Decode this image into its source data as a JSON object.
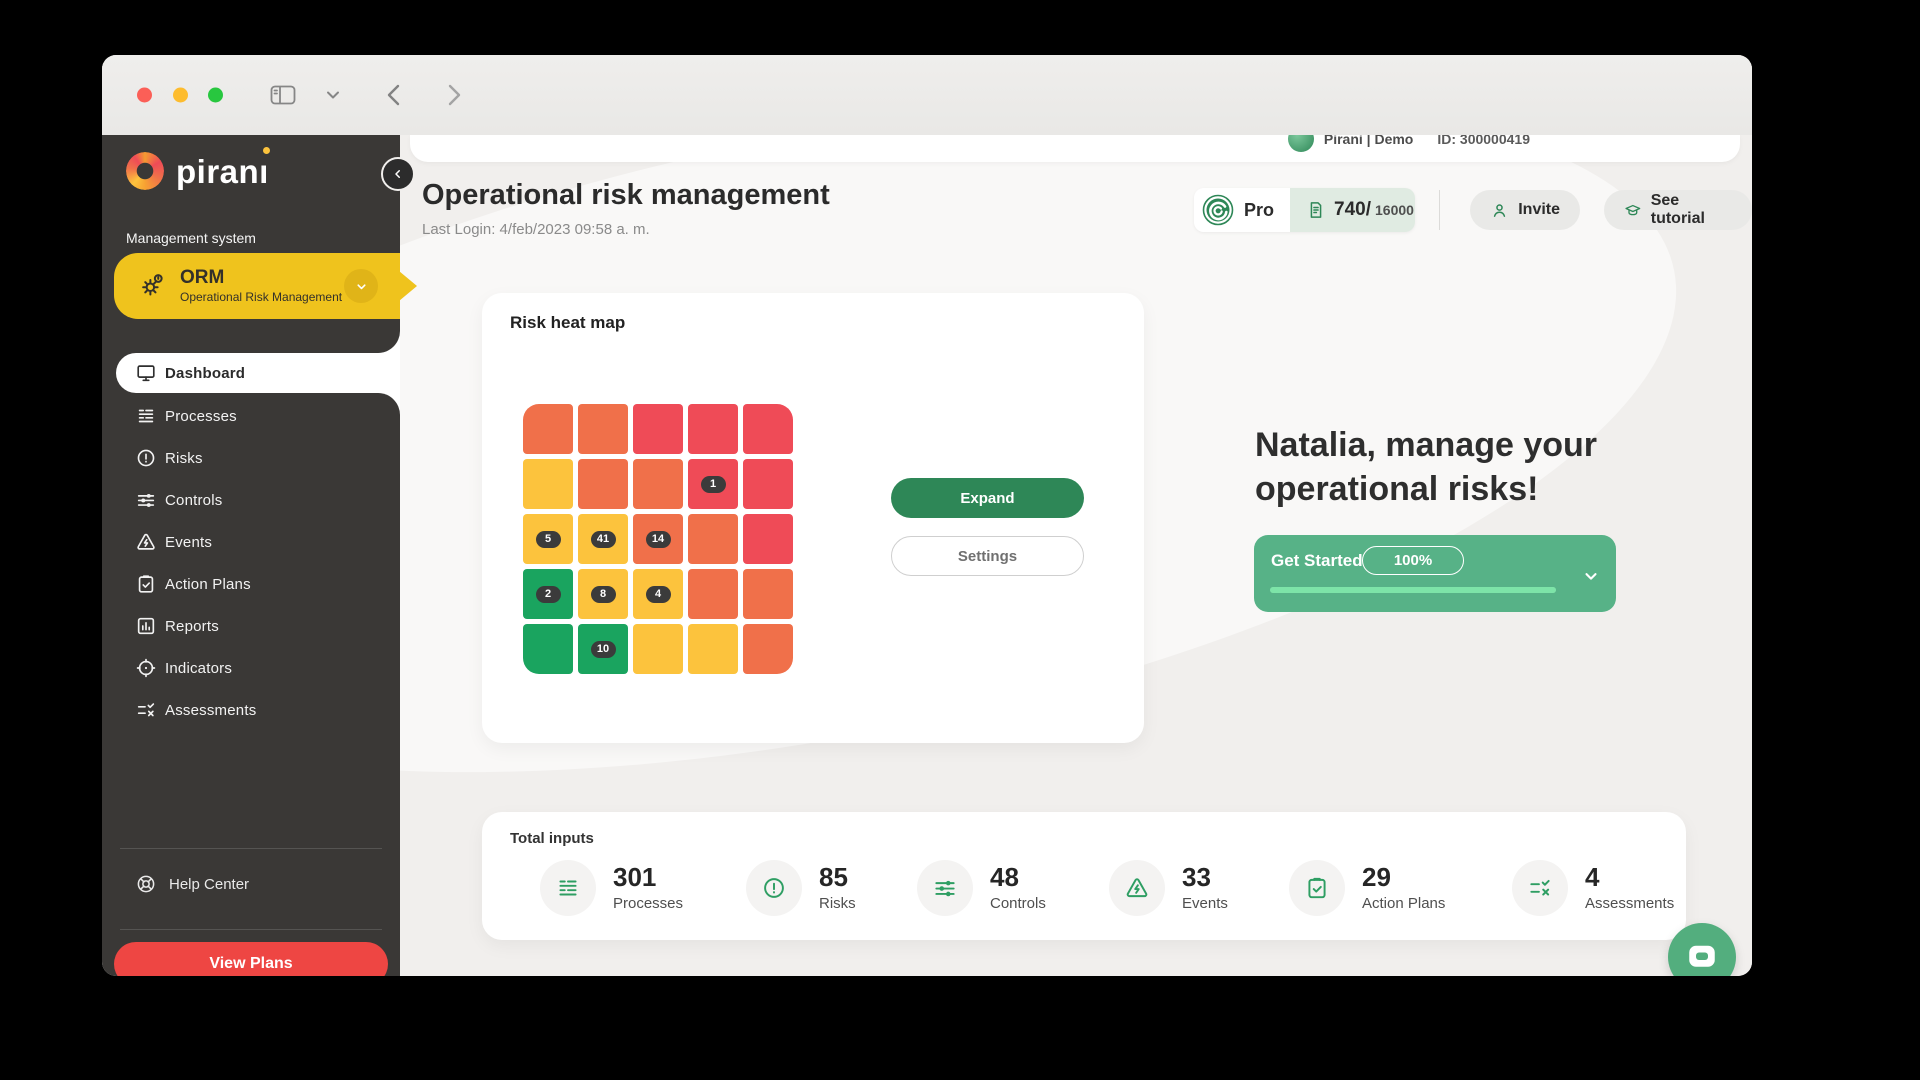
{
  "chrome": {
    "traffic_lights": [
      "close",
      "minimize",
      "zoom"
    ],
    "toolbar_icons": [
      "sidebar-toggle",
      "chevron-down",
      "back-arrow",
      "forward-arrow"
    ]
  },
  "sidebar": {
    "logo_text": "pirani",
    "section_label": "Management system",
    "orm": {
      "title": "ORM",
      "subtitle": "Operational Risk Management"
    },
    "items": [
      {
        "icon": "dashboard",
        "label": "Dashboard",
        "active": true
      },
      {
        "icon": "processes",
        "label": "Processes",
        "active": false
      },
      {
        "icon": "risks",
        "label": "Risks",
        "active": false
      },
      {
        "icon": "controls",
        "label": "Controls",
        "active": false
      },
      {
        "icon": "events",
        "label": "Events",
        "active": false
      },
      {
        "icon": "action-plans",
        "label": "Action Plans",
        "active": false
      },
      {
        "icon": "reports",
        "label": "Reports",
        "active": false
      },
      {
        "icon": "indicators",
        "label": "Indicators",
        "active": false
      },
      {
        "icon": "assessments",
        "label": "Assessments",
        "active": false
      }
    ],
    "help_center_label": "Help Center",
    "view_plans_label": "View Plans"
  },
  "topbar": {
    "account_name": "Pirani | Demo",
    "account_id": "ID: 300000419"
  },
  "header": {
    "title": "Operational risk management",
    "last_login": "Last Login: 4/feb/2023 09:58 a. m.",
    "plan_label": "Pro",
    "usage_used": "740/",
    "usage_total": "16000",
    "invite_label": "Invite",
    "tutorial_label": "See tutorial"
  },
  "heatmap": {
    "title": "Risk heat map",
    "expand_label": "Expand",
    "settings_label": "Settings",
    "colors": {
      "green": "#1aa45f",
      "yellow": "#fcc33d",
      "orange": "#f0704a",
      "red": "#ef4b57"
    },
    "rows": [
      [
        {
          "c": "orange"
        },
        {
          "c": "orange"
        },
        {
          "c": "red"
        },
        {
          "c": "red"
        },
        {
          "c": "red"
        }
      ],
      [
        {
          "c": "yellow"
        },
        {
          "c": "orange"
        },
        {
          "c": "orange"
        },
        {
          "c": "red",
          "b": "1"
        },
        {
          "c": "red"
        }
      ],
      [
        {
          "c": "yellow",
          "b": "5"
        },
        {
          "c": "yellow",
          "b": "41"
        },
        {
          "c": "orange",
          "b": "14"
        },
        {
          "c": "orange"
        },
        {
          "c": "red"
        }
      ],
      [
        {
          "c": "green",
          "b": "2"
        },
        {
          "c": "yellow",
          "b": "8"
        },
        {
          "c": "yellow",
          "b": "4"
        },
        {
          "c": "orange"
        },
        {
          "c": "orange"
        }
      ],
      [
        {
          "c": "green"
        },
        {
          "c": "green",
          "b": "10"
        },
        {
          "c": "yellow"
        },
        {
          "c": "yellow"
        },
        {
          "c": "orange"
        }
      ]
    ]
  },
  "welcome": {
    "line1": "Natalia, manage your",
    "line2": "operational risks!",
    "get_started_label": "Get Started",
    "progress_label": "100%",
    "progress_percent": 100
  },
  "totals": {
    "title": "Total inputs",
    "stats": [
      {
        "icon": "processes",
        "value": "301",
        "label": "Processes"
      },
      {
        "icon": "risks",
        "value": "85",
        "label": "Risks"
      },
      {
        "icon": "controls",
        "value": "48",
        "label": "Controls"
      },
      {
        "icon": "events",
        "value": "33",
        "label": "Events"
      },
      {
        "icon": "action-plans",
        "value": "29",
        "label": "Action Plans"
      },
      {
        "icon": "assessments",
        "value": "4",
        "label": "Assessments"
      }
    ]
  },
  "colors": {
    "accent_green": "#2e8757",
    "card_green": "#57b287",
    "progress_green": "#7de4a8",
    "sidebar_dark": "#3a3836",
    "brand_yellow": "#efc31d",
    "danger_red": "#ee4643",
    "traffic_red": "#fb5f57",
    "traffic_yellow": "#fdbc2e",
    "traffic_green": "#28c73f"
  }
}
